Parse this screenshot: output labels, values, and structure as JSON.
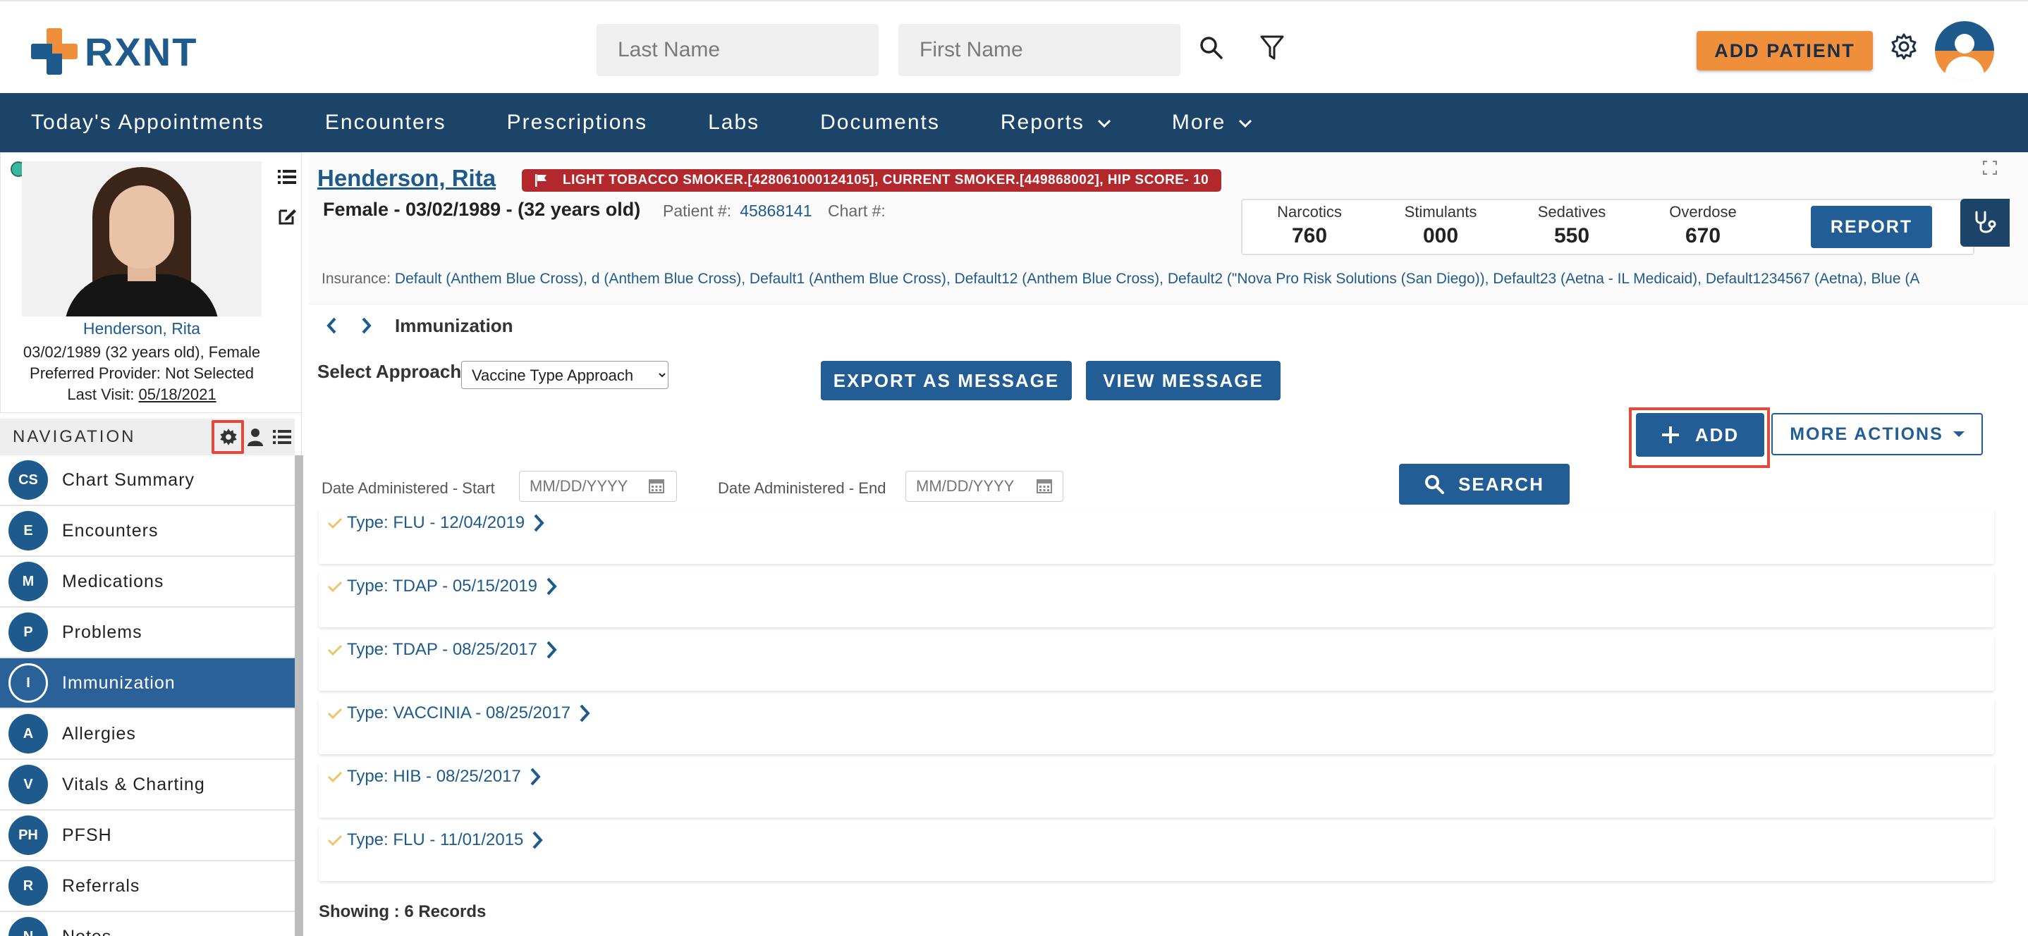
{
  "header": {
    "logo_text": "RXNT",
    "last_name_placeholder": "Last Name",
    "first_name_placeholder": "First Name",
    "add_patient_label": "ADD PATIENT"
  },
  "nav": {
    "items": [
      "Today's Appointments",
      "Encounters",
      "Prescriptions",
      "Labs",
      "Documents",
      "Reports",
      "More"
    ]
  },
  "patient_card": {
    "name": "Henderson, Rita",
    "dob_line": "03/02/1989 (32 years old), Female",
    "provider_line": "Preferred Provider: Not Selected",
    "last_visit_label": "Last Visit:",
    "last_visit_date": "05/18/2021"
  },
  "sidebar_nav": {
    "header": "NAVIGATION",
    "items": [
      {
        "badge": "CS",
        "label": "Chart Summary"
      },
      {
        "badge": "E",
        "label": "Encounters"
      },
      {
        "badge": "M",
        "label": "Medications"
      },
      {
        "badge": "P",
        "label": "Problems"
      },
      {
        "badge": "I",
        "label": "Immunization"
      },
      {
        "badge": "A",
        "label": "Allergies"
      },
      {
        "badge": "V",
        "label": "Vitals & Charting"
      },
      {
        "badge": "PH",
        "label": "PFSH"
      },
      {
        "badge": "R",
        "label": "Referrals"
      },
      {
        "badge": "N",
        "label": "Notes"
      }
    ],
    "active_index": 4
  },
  "patient": {
    "name": "Henderson, Rita",
    "flags": "LIGHT TOBACCO SMOKER.[428061000124105], CURRENT SMOKER.[449868002], HIP SCORE- 10",
    "demographics": "Female - 03/02/1989 - (32 years old)",
    "patient_num_label": "Patient #:",
    "patient_num": "45868141",
    "chart_num_label": "Chart #:",
    "insurance_label": "Insurance:",
    "insurance": "Default (Anthem Blue Cross), d (Anthem Blue Cross), Default1 (Anthem Blue Cross), Default12 (Anthem Blue Cross), Default2 (\"Nova Pro Risk Solutions (San Diego)), Default23 (Aetna - IL Medicaid), Default1234567 (Aetna), Blue (A"
  },
  "pdmp": {
    "scores": [
      {
        "label": "Narcotics",
        "value": "760"
      },
      {
        "label": "Stimulants",
        "value": "000"
      },
      {
        "label": "Sedatives",
        "value": "550"
      },
      {
        "label": "Overdose",
        "value": "670"
      }
    ],
    "report_label": "REPORT"
  },
  "page": {
    "title": "Immunization",
    "approach_label": "Select Approach",
    "approach_value": "Vaccine Type Approach",
    "export_label": "EXPORT AS MESSAGE",
    "view_label": "VIEW MESSAGE",
    "add_label": "ADD",
    "more_actions_label": "MORE ACTIONS",
    "date_start_label": "Date Administered - Start",
    "date_end_label": "Date Administered - End",
    "date_placeholder": "MM/DD/YYYY",
    "search_label": "SEARCH",
    "records": [
      "Type: FLU - 12/04/2019",
      "Type: TDAP - 05/15/2019",
      "Type: TDAP - 08/25/2017",
      "Type: VACCINIA - 08/25/2017",
      "Type: HIB - 08/25/2017",
      "Type: FLU - 11/01/2015"
    ],
    "showing_label": "Showing : 6 Records"
  },
  "colors": {
    "brand_blue": "#1f5a8c",
    "brand_orange": "#ef8f3c",
    "nav_bg": "#1b4468",
    "flag_red": "#b3282d",
    "highlight_red": "#e24b3b"
  }
}
